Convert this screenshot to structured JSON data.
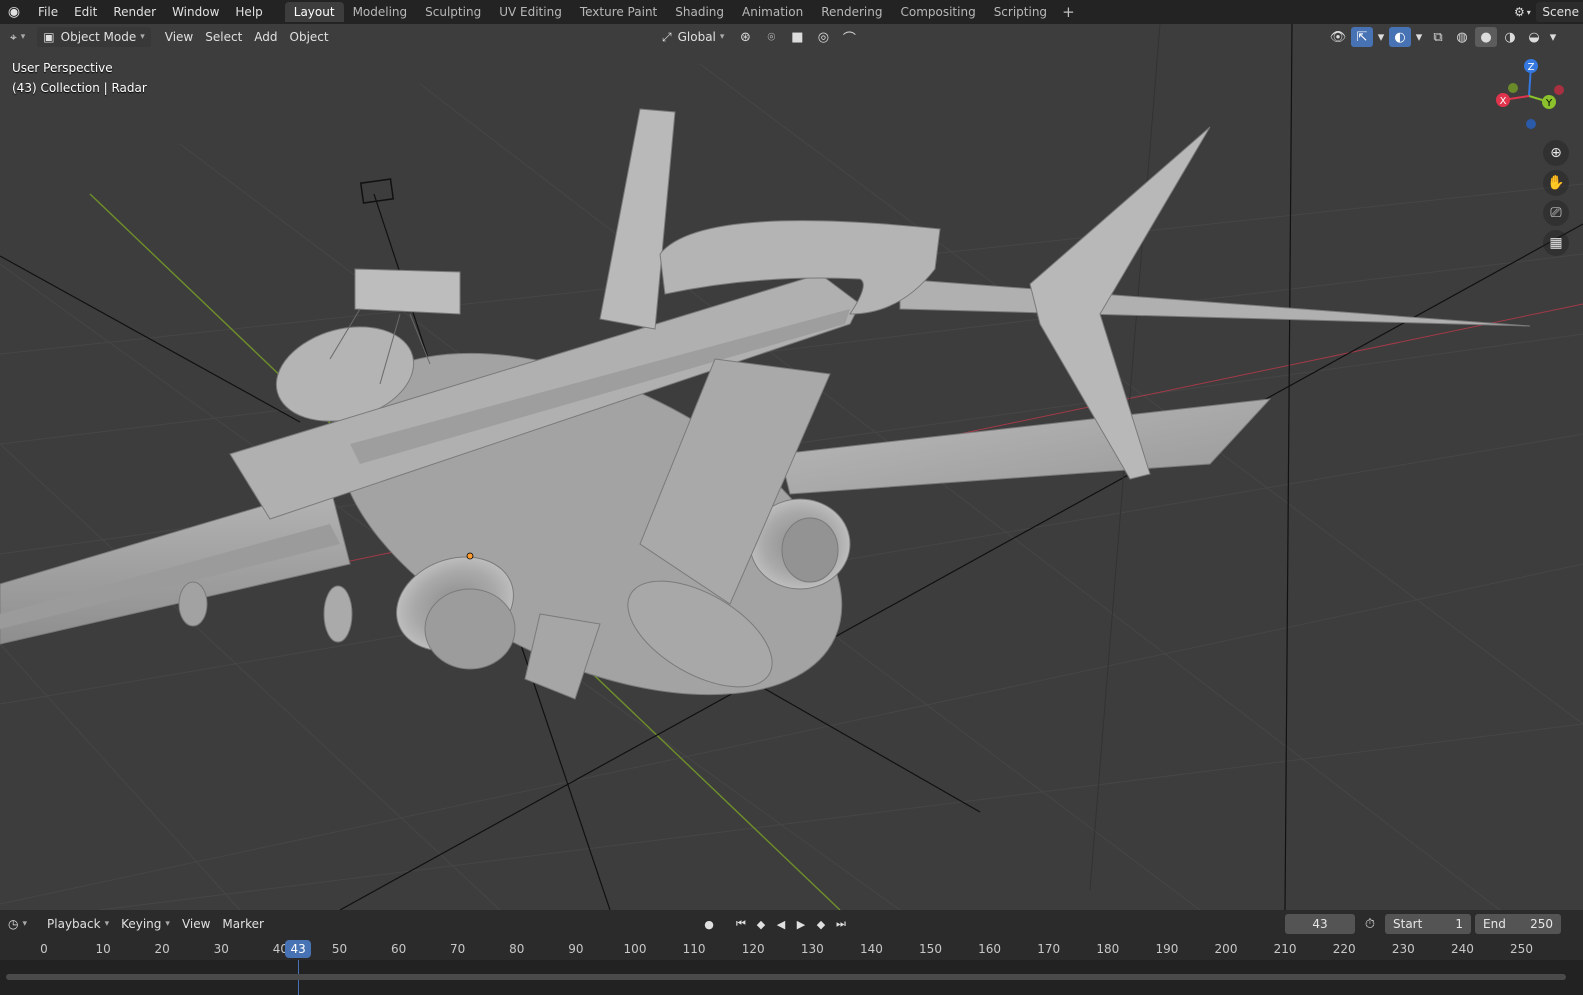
{
  "topbar": {
    "menu": [
      "File",
      "Edit",
      "Render",
      "Window",
      "Help"
    ],
    "workspaces": [
      "Layout",
      "Modeling",
      "Sculpting",
      "UV Editing",
      "Texture Paint",
      "Shading",
      "Animation",
      "Rendering",
      "Compositing",
      "Scripting"
    ],
    "active_workspace": "Layout",
    "add_workspace": "+",
    "scene_name": "Scene"
  },
  "viewport_header": {
    "mode": "Object Mode",
    "menus": [
      "View",
      "Select",
      "Add",
      "Object"
    ],
    "orientation": "Global"
  },
  "viewport": {
    "perspective": "User Perspective",
    "collection_info": "(43) Collection | Radar",
    "gizmo_axes": {
      "x": "X",
      "y": "Y",
      "z": "Z"
    },
    "colors": {
      "x": "#e0344c",
      "y": "#8bc12c",
      "z": "#3478e0",
      "grid_bg": "#3d3d3d",
      "model": "#a6a6a6"
    }
  },
  "timeline": {
    "menus": [
      "Playback",
      "Keying",
      "View",
      "Marker"
    ],
    "current_frame": "43",
    "start_label": "Start",
    "start_value": "1",
    "end_label": "End",
    "end_value": "250",
    "ticks": [
      "0",
      "10",
      "20",
      "30",
      "40",
      "50",
      "60",
      "70",
      "80",
      "90",
      "100",
      "110",
      "120",
      "130",
      "140",
      "150",
      "160",
      "170",
      "180",
      "190",
      "200",
      "210",
      "220",
      "230",
      "240",
      "250"
    ]
  }
}
